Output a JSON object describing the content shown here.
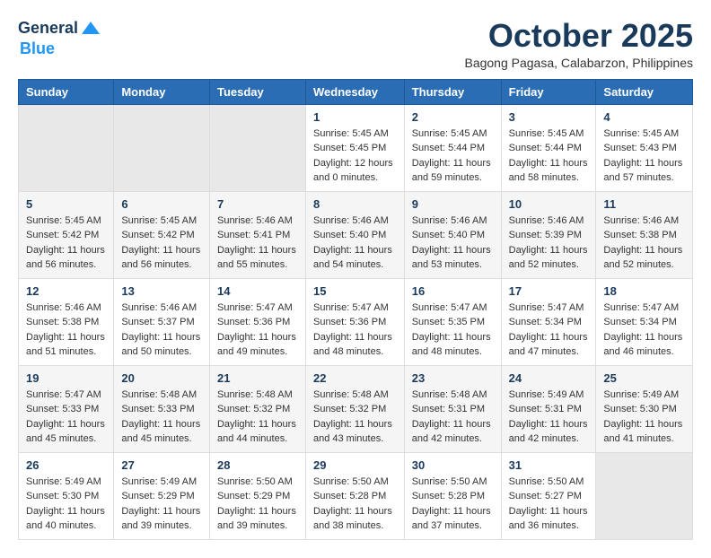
{
  "header": {
    "logo_line1": "General",
    "logo_line2": "Blue",
    "month_title": "October 2025",
    "subtitle": "Bagong Pagasa, Calabarzon, Philippines"
  },
  "days_of_week": [
    "Sunday",
    "Monday",
    "Tuesday",
    "Wednesday",
    "Thursday",
    "Friday",
    "Saturday"
  ],
  "weeks": [
    [
      {
        "day": "",
        "info": ""
      },
      {
        "day": "",
        "info": ""
      },
      {
        "day": "",
        "info": ""
      },
      {
        "day": "1",
        "info": "Sunrise: 5:45 AM\nSunset: 5:45 PM\nDaylight: 12 hours\nand 0 minutes."
      },
      {
        "day": "2",
        "info": "Sunrise: 5:45 AM\nSunset: 5:44 PM\nDaylight: 11 hours\nand 59 minutes."
      },
      {
        "day": "3",
        "info": "Sunrise: 5:45 AM\nSunset: 5:44 PM\nDaylight: 11 hours\nand 58 minutes."
      },
      {
        "day": "4",
        "info": "Sunrise: 5:45 AM\nSunset: 5:43 PM\nDaylight: 11 hours\nand 57 minutes."
      }
    ],
    [
      {
        "day": "5",
        "info": "Sunrise: 5:45 AM\nSunset: 5:42 PM\nDaylight: 11 hours\nand 56 minutes."
      },
      {
        "day": "6",
        "info": "Sunrise: 5:45 AM\nSunset: 5:42 PM\nDaylight: 11 hours\nand 56 minutes."
      },
      {
        "day": "7",
        "info": "Sunrise: 5:46 AM\nSunset: 5:41 PM\nDaylight: 11 hours\nand 55 minutes."
      },
      {
        "day": "8",
        "info": "Sunrise: 5:46 AM\nSunset: 5:40 PM\nDaylight: 11 hours\nand 54 minutes."
      },
      {
        "day": "9",
        "info": "Sunrise: 5:46 AM\nSunset: 5:40 PM\nDaylight: 11 hours\nand 53 minutes."
      },
      {
        "day": "10",
        "info": "Sunrise: 5:46 AM\nSunset: 5:39 PM\nDaylight: 11 hours\nand 52 minutes."
      },
      {
        "day": "11",
        "info": "Sunrise: 5:46 AM\nSunset: 5:38 PM\nDaylight: 11 hours\nand 52 minutes."
      }
    ],
    [
      {
        "day": "12",
        "info": "Sunrise: 5:46 AM\nSunset: 5:38 PM\nDaylight: 11 hours\nand 51 minutes."
      },
      {
        "day": "13",
        "info": "Sunrise: 5:46 AM\nSunset: 5:37 PM\nDaylight: 11 hours\nand 50 minutes."
      },
      {
        "day": "14",
        "info": "Sunrise: 5:47 AM\nSunset: 5:36 PM\nDaylight: 11 hours\nand 49 minutes."
      },
      {
        "day": "15",
        "info": "Sunrise: 5:47 AM\nSunset: 5:36 PM\nDaylight: 11 hours\nand 48 minutes."
      },
      {
        "day": "16",
        "info": "Sunrise: 5:47 AM\nSunset: 5:35 PM\nDaylight: 11 hours\nand 48 minutes."
      },
      {
        "day": "17",
        "info": "Sunrise: 5:47 AM\nSunset: 5:34 PM\nDaylight: 11 hours\nand 47 minutes."
      },
      {
        "day": "18",
        "info": "Sunrise: 5:47 AM\nSunset: 5:34 PM\nDaylight: 11 hours\nand 46 minutes."
      }
    ],
    [
      {
        "day": "19",
        "info": "Sunrise: 5:47 AM\nSunset: 5:33 PM\nDaylight: 11 hours\nand 45 minutes."
      },
      {
        "day": "20",
        "info": "Sunrise: 5:48 AM\nSunset: 5:33 PM\nDaylight: 11 hours\nand 45 minutes."
      },
      {
        "day": "21",
        "info": "Sunrise: 5:48 AM\nSunset: 5:32 PM\nDaylight: 11 hours\nand 44 minutes."
      },
      {
        "day": "22",
        "info": "Sunrise: 5:48 AM\nSunset: 5:32 PM\nDaylight: 11 hours\nand 43 minutes."
      },
      {
        "day": "23",
        "info": "Sunrise: 5:48 AM\nSunset: 5:31 PM\nDaylight: 11 hours\nand 42 minutes."
      },
      {
        "day": "24",
        "info": "Sunrise: 5:49 AM\nSunset: 5:31 PM\nDaylight: 11 hours\nand 42 minutes."
      },
      {
        "day": "25",
        "info": "Sunrise: 5:49 AM\nSunset: 5:30 PM\nDaylight: 11 hours\nand 41 minutes."
      }
    ],
    [
      {
        "day": "26",
        "info": "Sunrise: 5:49 AM\nSunset: 5:30 PM\nDaylight: 11 hours\nand 40 minutes."
      },
      {
        "day": "27",
        "info": "Sunrise: 5:49 AM\nSunset: 5:29 PM\nDaylight: 11 hours\nand 39 minutes."
      },
      {
        "day": "28",
        "info": "Sunrise: 5:50 AM\nSunset: 5:29 PM\nDaylight: 11 hours\nand 39 minutes."
      },
      {
        "day": "29",
        "info": "Sunrise: 5:50 AM\nSunset: 5:28 PM\nDaylight: 11 hours\nand 38 minutes."
      },
      {
        "day": "30",
        "info": "Sunrise: 5:50 AM\nSunset: 5:28 PM\nDaylight: 11 hours\nand 37 minutes."
      },
      {
        "day": "31",
        "info": "Sunrise: 5:50 AM\nSunset: 5:27 PM\nDaylight: 11 hours\nand 36 minutes."
      },
      {
        "day": "",
        "info": ""
      }
    ]
  ]
}
